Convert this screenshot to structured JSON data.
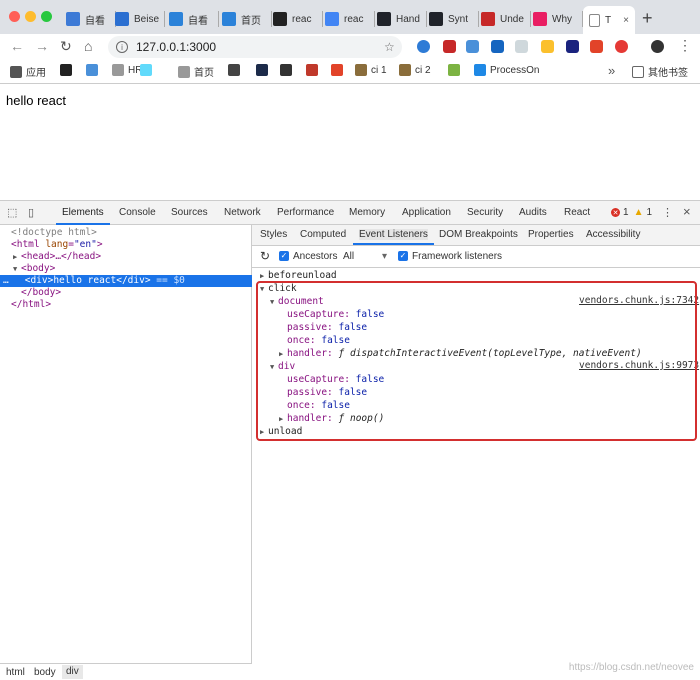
{
  "browser": {
    "tabs": [
      {
        "label": "自看",
        "color": "#3d7ad6"
      },
      {
        "label": "Beise",
        "color": "#2b6fd1"
      },
      {
        "label": "自看",
        "color": "#2b82d9"
      },
      {
        "label": "首页",
        "color": "#2b82d9"
      },
      {
        "label": "reac",
        "color": "#222222"
      },
      {
        "label": "reac",
        "color": "#4285f4"
      },
      {
        "label": "Hand",
        "color": "#20232a"
      },
      {
        "label": "Synt",
        "color": "#20232a"
      },
      {
        "label": "Unde",
        "color": "#c62828"
      },
      {
        "label": "Why",
        "color": "#e91e63"
      }
    ],
    "active_tab": "T",
    "new_tab": "+",
    "url": "127.0.0.1:3000",
    "info_glyph": "i",
    "nav": {
      "back": "←",
      "forward": "→",
      "reload": "↻",
      "home": "⌂"
    },
    "bookmarks": [
      {
        "label": "应用",
        "color": "#555555"
      },
      {
        "label": "",
        "color": "#222222"
      },
      {
        "label": "",
        "color": "#4a90d9"
      },
      {
        "label": "HR",
        "color": "#999999"
      },
      {
        "label": "",
        "color": "#61dafb"
      },
      {
        "label": "首页",
        "color": "#999999"
      },
      {
        "label": "",
        "color": "#444444"
      },
      {
        "label": "",
        "color": "#1c2b4a"
      },
      {
        "label": "",
        "color": "#333333"
      },
      {
        "label": "",
        "color": "#c0392b"
      },
      {
        "label": "",
        "color": "#e24329"
      },
      {
        "label": "ci 1",
        "color": "#8a6d3b"
      },
      {
        "label": "ci 2",
        "color": "#8a6d3b"
      },
      {
        "label": "",
        "color": "#7cb342"
      },
      {
        "label": "ProcessOn",
        "color": "#1e88e5"
      }
    ],
    "bookmarks_more": "»",
    "other_bookmarks": "其他书签"
  },
  "page": {
    "text": "hello react"
  },
  "devtools": {
    "tabs": [
      "Elements",
      "Console",
      "Sources",
      "Network",
      "Performance",
      "Memory",
      "Application",
      "Security",
      "Audits",
      "React"
    ],
    "active_tab": "Elements",
    "errors": "1",
    "warnings": "1",
    "elements_tree": {
      "doctype": "<!doctype html>",
      "html_open": "<html ",
      "lang_attr": "lang",
      "lang_val": "\"en\"",
      "html_close_bracket": ">",
      "head": "<head>…</head>",
      "body_open": "<body>",
      "selected_prefix": "…",
      "selected_node": "<div>hello react</div>",
      "selected_suffix": " == $0",
      "body_close": "</body>",
      "html_close": "</html>"
    },
    "breadcrumbs": [
      "html",
      "body",
      "div"
    ],
    "side_tabs": [
      "Styles",
      "Computed",
      "Event Listeners",
      "DOM Breakpoints",
      "Properties",
      "Accessibility"
    ],
    "active_side_tab": "Event Listeners",
    "filter": {
      "ancestors_label": "Ancestors",
      "ancestors_select": "All",
      "framework_label": "Framework listeners",
      "refresh": "↻",
      "check": "✓",
      "select_caret": "▾"
    },
    "listeners": {
      "beforeunload": "beforeunload",
      "click": "click",
      "unload": "unload",
      "document": {
        "target": "document",
        "source": "vendors.chunk.js:7342",
        "useCapture": "false",
        "passive": "false",
        "once": "false",
        "handler": "dispatchInteractiveEvent(topLevelType, nativeEvent)"
      },
      "div": {
        "target": "div",
        "source": "vendors.chunk.js:9973",
        "useCapture": "false",
        "passive": "false",
        "once": "false",
        "handler": "noop()"
      },
      "labels": {
        "useCapture": "useCapture:",
        "passive": "passive:",
        "once": "once:",
        "handler": "handler:",
        "f": "ƒ"
      }
    }
  },
  "watermark": "https://blog.csdn.net/neovee"
}
